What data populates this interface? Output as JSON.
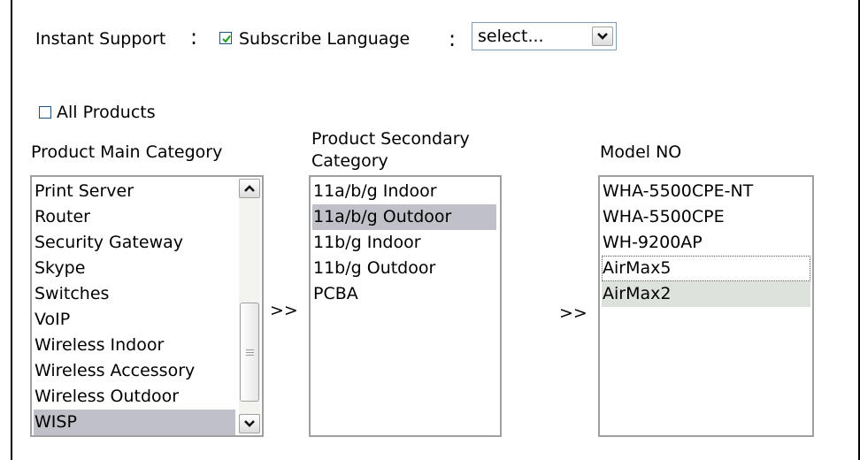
{
  "header": {
    "instant_support_label": "Instant Support",
    "instant_support_colon": ":",
    "subscribe_checked": true,
    "subscribe_language_label": "Subscribe Language",
    "subscribe_language_colon": ":",
    "language_select_value": "select..."
  },
  "all_products": {
    "label": "All Products",
    "checked": false
  },
  "arrow_label": ">>",
  "main_category": {
    "title": "Product Main Category",
    "items": [
      "Print Server",
      "Router",
      "Security Gateway",
      "Skype",
      "Switches",
      "VoIP",
      "Wireless Indoor",
      "Wireless Accessory",
      "Wireless Outdoor",
      "WISP"
    ],
    "selected": "WISP"
  },
  "secondary_category": {
    "title_line1": "Product Secondary",
    "title_line2": "Category",
    "items": [
      "11a/b/g Indoor",
      "11a/b/g Outdoor",
      "11b/g Indoor",
      "11b/g Outdoor",
      "PCBA"
    ],
    "selected": "11a/b/g Outdoor"
  },
  "model_no": {
    "title": "Model NO",
    "items": [
      "WHA-5500CPE-NT",
      "WHA-5500CPE",
      "WH-9200AP",
      "AirMax5",
      "AirMax2"
    ],
    "focused": "AirMax5",
    "selected": "AirMax2"
  },
  "colors": {
    "selection": "#c0c0c8",
    "selection_light": "#dde2dd",
    "checkbox_border": "#1c5180",
    "checkmark": "#21a121"
  }
}
